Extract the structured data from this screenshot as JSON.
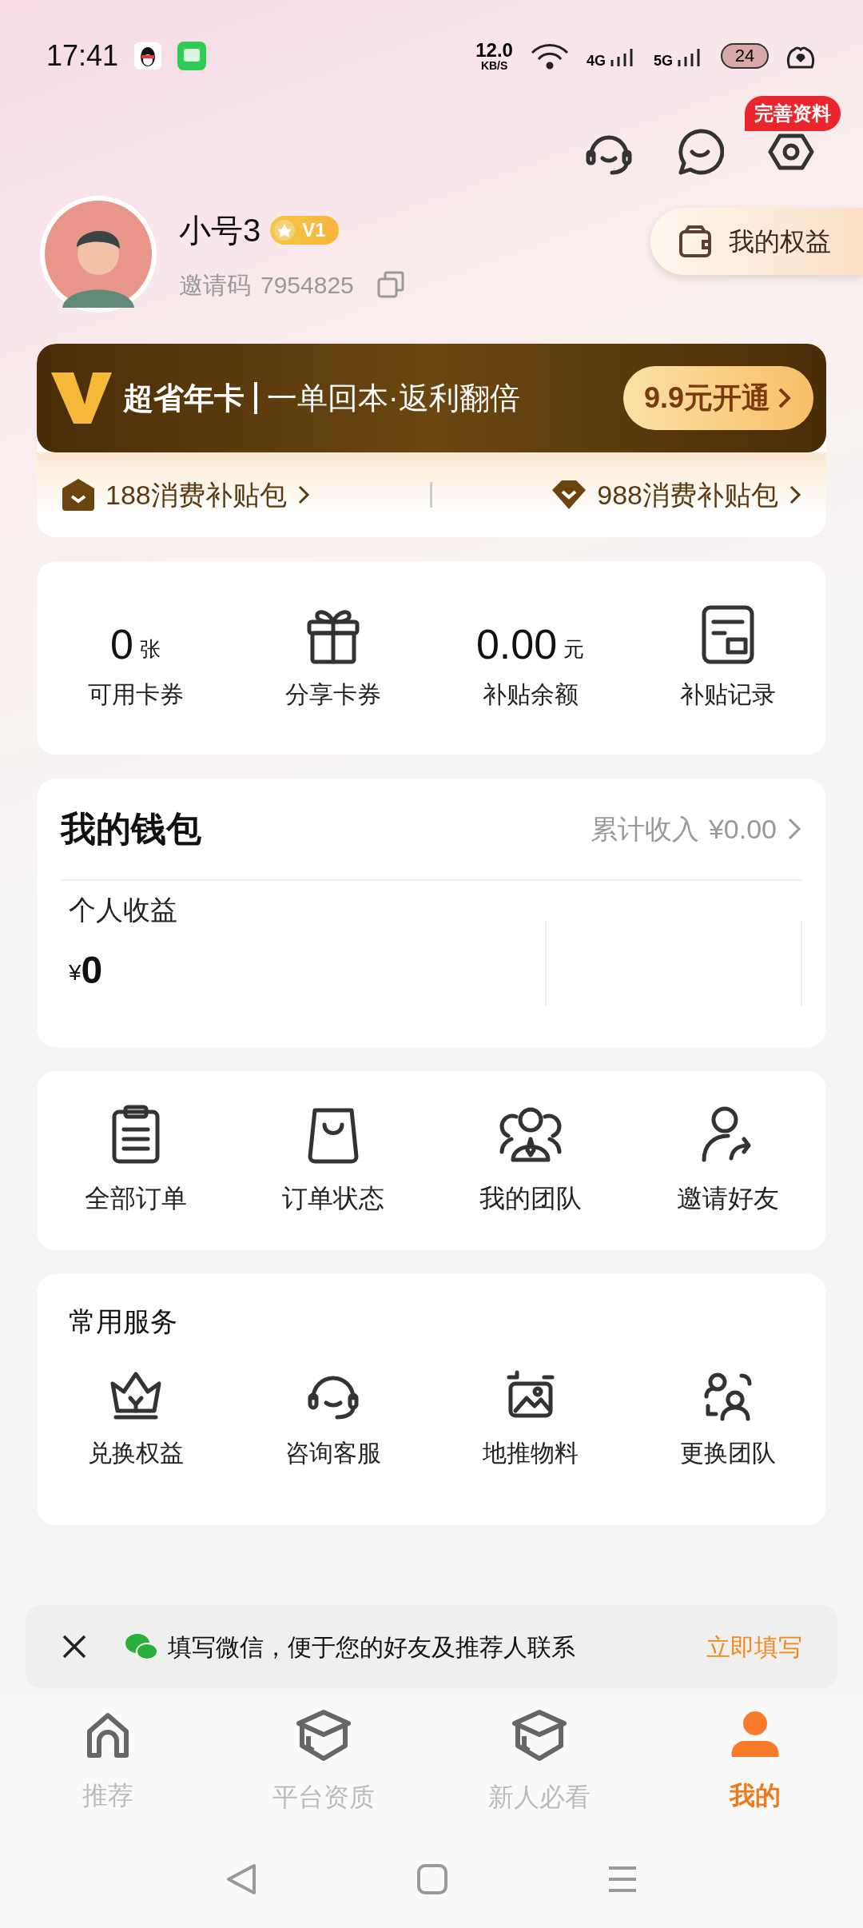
{
  "status_bar": {
    "time": "17:41",
    "speed": "12.0",
    "speed_unit": "KB/S",
    "signal_1": "4G",
    "signal_2": "5G",
    "battery": "24"
  },
  "header": {
    "profile_badge": "完善资料"
  },
  "profile": {
    "name": "小号3",
    "level": "V1",
    "invite_label": "邀请码",
    "invite_code": "7954825",
    "rights_button": "我的权益"
  },
  "vip_card": {
    "title": "超省年卡",
    "slogan": "一单回本·返利翻倍",
    "button": "9.9元开通",
    "packs": [
      "188消费补贴包",
      "988消费补贴包"
    ]
  },
  "stats": [
    {
      "kind": "value",
      "value": "0",
      "unit": "张",
      "label": "可用卡券"
    },
    {
      "kind": "icon",
      "label": "分享卡券"
    },
    {
      "kind": "value",
      "value": "0.00",
      "unit": "元",
      "label": "补贴余额"
    },
    {
      "kind": "icon",
      "label": "补贴记录"
    }
  ],
  "wallet": {
    "title": "我的钱包",
    "total_label": "累计收入",
    "total": "¥0.00",
    "personal_label": "个人收益",
    "currency": "¥",
    "amount": "0"
  },
  "orders": [
    "全部订单",
    "订单状态",
    "我的团队",
    "邀请好友"
  ],
  "services": {
    "title": "常用服务",
    "items": [
      "兑换权益",
      "咨询客服",
      "地推物料",
      "更换团队"
    ]
  },
  "notice": {
    "text": "填写微信，便于您的好友及推荐人联系",
    "action": "立即填写"
  },
  "tabs": [
    {
      "label": "推荐",
      "selected": false
    },
    {
      "label": "平台资质",
      "selected": false
    },
    {
      "label": "新人必看",
      "selected": false
    },
    {
      "label": "我的",
      "selected": true
    }
  ]
}
